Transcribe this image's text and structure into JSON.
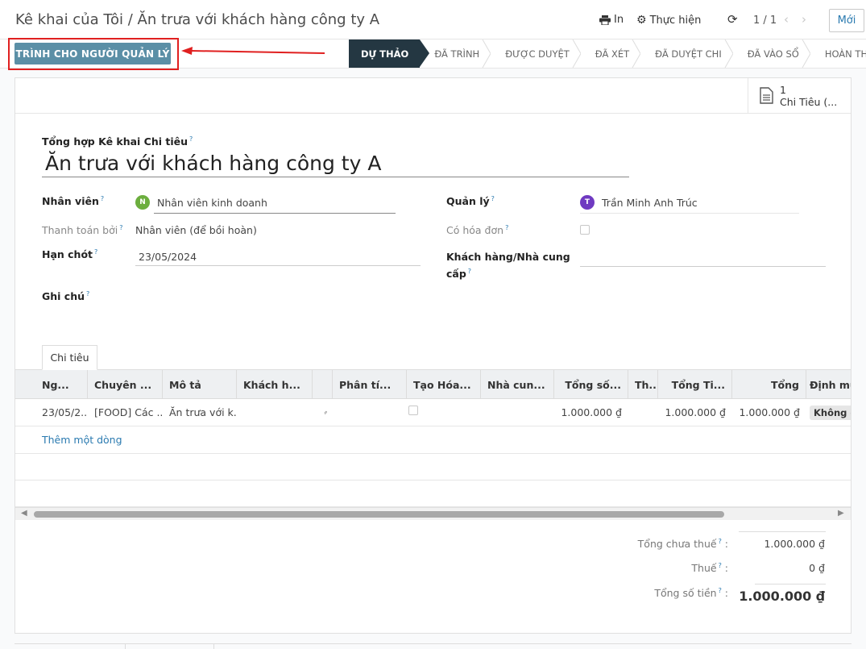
{
  "breadcrumb": {
    "parent": "Kê khai của Tôi",
    "separator": " / ",
    "current": "Ăn trưa với khách hàng công ty A"
  },
  "toolbar": {
    "print_label": "In",
    "action_label": "Thực hiện",
    "pager": "1 / 1",
    "new_label": "Mới"
  },
  "statusbar": {
    "submit_label": "TRÌNH CHO NGƯỜI QUẢN LÝ",
    "stages": [
      "DỰ THẢO",
      "ĐÃ TRÌNH",
      "ĐƯỢC DUYỆT",
      "ĐÃ XÉT",
      "ĐÃ DUYỆT CHI",
      "ĐÃ VÀO SỔ",
      "HOÀN THÀNH"
    ],
    "active_stage": "DỰ THẢO"
  },
  "smart_button": {
    "count": "1",
    "label": "Chi Tiêu (..."
  },
  "form": {
    "title_label": "Tổng hợp Kê khai Chi tiêu",
    "title_value": "Ăn trưa với khách hàng công ty A",
    "employee_label": "Nhân viên",
    "employee_initial": "N",
    "employee_value": "Nhân viên kinh doanh",
    "manager_label": "Quản lý",
    "manager_initial": "T",
    "manager_value": "Trần Minh Anh Trúc",
    "paid_by_label": "Thanh toán bởi",
    "paid_by_value": "Nhân viên (để bồi hoàn)",
    "has_invoice_label": "Có hóa đơn",
    "deadline_label": "Hạn chót",
    "deadline_value": "23/05/2024",
    "partner_label_1": "Khách hàng/Nhà cung",
    "partner_label_2": "cấp",
    "note_label": "Ghi chú",
    "help_mark": "?"
  },
  "tabs": {
    "expenses": "Chi tiêu"
  },
  "table": {
    "headers": [
      "Ng...",
      "Chuyên ...",
      "Mô tả",
      "Khách h...",
      "",
      "Phân tí...",
      "Tạo Hóa...",
      "Nhà cun...",
      "Tổng số...",
      "Th...",
      "Tổng Ti...",
      "Tổng",
      "Định mức"
    ],
    "row": {
      "date": "23/05/2...",
      "product": "[FOOD] Các ...",
      "description": "Ăn trưa với k...",
      "amount": "1.000.000 ₫",
      "amount_total": "1.000.000 ₫",
      "total": "1.000.000 ₫",
      "norm": "Không đi"
    },
    "add_line": "Thêm một dòng"
  },
  "totals": {
    "untaxed_label": "Tổng chưa thuế",
    "untaxed_value": "1.000.000 ₫",
    "tax_label": "Thuế",
    "tax_value": "0 ₫",
    "total_label": "Tổng số tiền",
    "total_value": "1.000.000 ₫"
  },
  "colors": {
    "primary": "#5b8fa6",
    "active_stage": "#243742",
    "highlight": "#e02020",
    "link": "#2a7ab0",
    "avatar_n": "#6cae3e",
    "avatar_t": "#6f3ac1"
  }
}
